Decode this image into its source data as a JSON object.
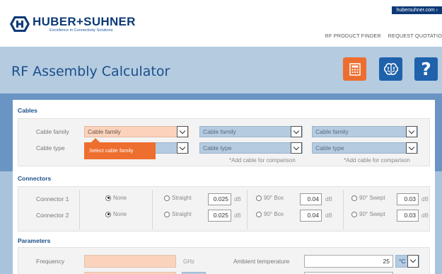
{
  "topbar": {
    "external_link": "hubersuhner.com ›",
    "logo_name": "HUBER+SUHNER",
    "logo_tagline": "Excellence in Connectivity Solutions",
    "nav": [
      "RF PRODUCT FINDER",
      "REQUEST QUOTATIO"
    ]
  },
  "header": {
    "title": "RF Assembly Calculator",
    "buttons": [
      {
        "name": "calculator",
        "icon": "calculator-icon",
        "color": "#ee6e2f"
      },
      {
        "name": "brain",
        "icon": "brain-icon",
        "color": "#1f62ab"
      },
      {
        "name": "help",
        "label": "?",
        "color": "#1f62ab"
      }
    ]
  },
  "cables": {
    "title": "Cables",
    "family_label": "Cable family",
    "type_label": "Cable type",
    "columns": [
      {
        "family": "Cable family",
        "type": "Cable type",
        "note": ""
      },
      {
        "family": "Cable family",
        "type": "Cable type",
        "note": "*Add cable for comparison"
      },
      {
        "family": "Cable family",
        "type": "Cable type",
        "note": "*Add cable for comparison"
      }
    ],
    "tooltip": "Select cable family"
  },
  "connectors": {
    "title": "Connectors",
    "rows": [
      {
        "label": "Connector 1",
        "none": "None",
        "straight": "Straight",
        "straight_val": "0.025",
        "box": "90° Box",
        "box_val": "0.04",
        "swept": "90° Swept",
        "swept_val": "0.03",
        "unit": "dB"
      },
      {
        "label": "Connector 2",
        "none": "None",
        "straight": "Straight",
        "straight_val": "0.025",
        "box": "90° Box",
        "box_val": "0.04",
        "swept": "90° Swept",
        "swept_val": "0.03",
        "unit": "dB"
      }
    ]
  },
  "parameters": {
    "title": "Parameters",
    "frequency_label": "Frequency",
    "frequency_unit": "GHz",
    "ambient_label": "Ambient temperature",
    "ambient_value": "25",
    "ambient_unit": "°C"
  },
  "colors": {
    "brand_blue": "#0d3a77",
    "accent_orange": "#ee6e2f",
    "header_band": "#b4cbe0",
    "peach_field": "#fbd3bd"
  }
}
